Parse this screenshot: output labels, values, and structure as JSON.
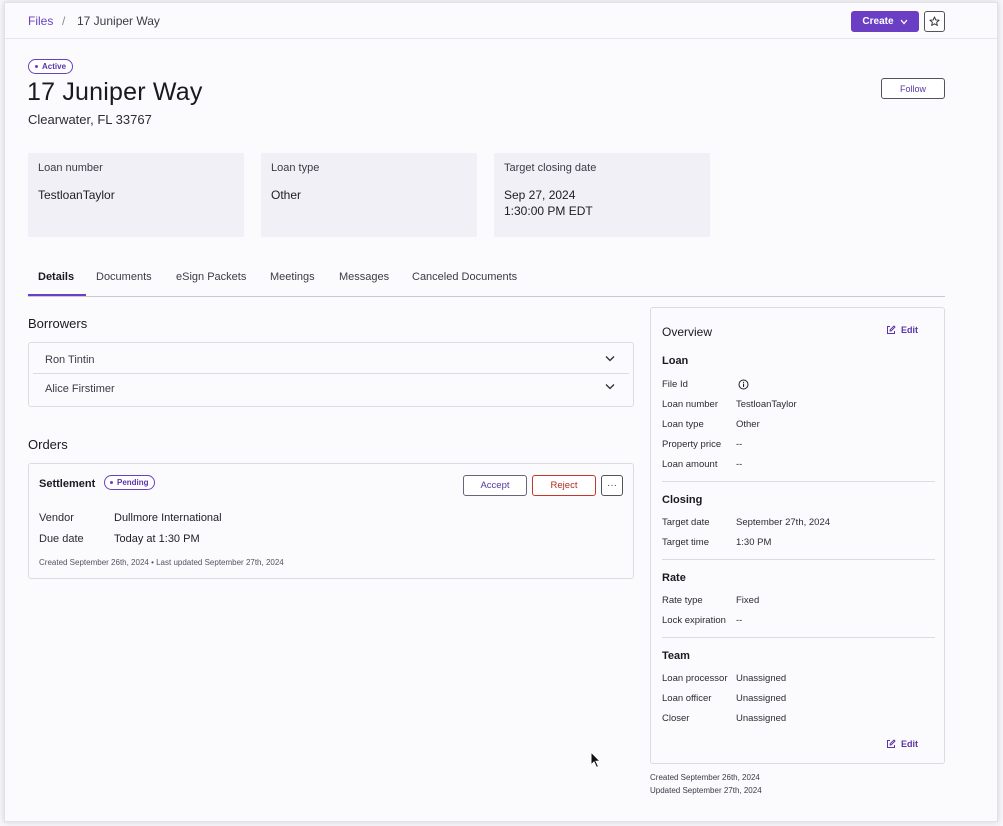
{
  "breadcrumb": {
    "root": "Files",
    "separator": "/",
    "current": "17 Juniper Way"
  },
  "toolbar": {
    "create_label": "Create"
  },
  "header": {
    "status": "Active",
    "title": "17 Juniper Way",
    "address": "Clearwater, FL 33767",
    "follow_label": "Follow"
  },
  "cards": [
    {
      "label": "Loan number",
      "value": "TestloanTaylor"
    },
    {
      "label": "Loan type",
      "value": "Other"
    },
    {
      "label": "Target closing date",
      "value_line1": "Sep 27, 2024",
      "value_line2": "1:30:00 PM EDT"
    }
  ],
  "tabs": [
    {
      "label": "Details"
    },
    {
      "label": "Documents"
    },
    {
      "label": "eSign Packets"
    },
    {
      "label": "Meetings"
    },
    {
      "label": "Messages"
    },
    {
      "label": "Canceled Documents"
    }
  ],
  "borrowers": {
    "heading": "Borrowers",
    "items": [
      {
        "name": "Ron Tintin"
      },
      {
        "name": "Alice Firstimer"
      }
    ]
  },
  "orders": {
    "heading": "Orders",
    "order": {
      "title": "Settlement",
      "status": "Pending",
      "accept_label": "Accept",
      "reject_label": "Reject",
      "more_label": "···",
      "vendor_label": "Vendor",
      "vendor_value": "Dullmore International",
      "due_label": "Due date",
      "due_value": "Today at 1:30 PM",
      "meta": "Created September 26th, 2024 • Last updated September 27th, 2024"
    }
  },
  "overview": {
    "title": "Overview",
    "edit_label": "Edit",
    "loan": {
      "heading": "Loan",
      "file_id_label": "File Id",
      "loan_number_label": "Loan number",
      "loan_number_value": "TestloanTaylor",
      "loan_type_label": "Loan type",
      "loan_type_value": "Other",
      "property_price_label": "Property price",
      "property_price_value": "--",
      "loan_amount_label": "Loan amount",
      "loan_amount_value": "--"
    },
    "closing": {
      "heading": "Closing",
      "target_date_label": "Target date",
      "target_date_value": "September 27th, 2024",
      "target_time_label": "Target time",
      "target_time_value": "1:30 PM"
    },
    "rate": {
      "heading": "Rate",
      "rate_type_label": "Rate type",
      "rate_type_value": "Fixed",
      "lock_expiration_label": "Lock expiration",
      "lock_expiration_value": "--"
    },
    "team": {
      "heading": "Team",
      "loan_processor_label": "Loan processor",
      "loan_processor_value": "Unassigned",
      "loan_officer_label": "Loan officer",
      "loan_officer_value": "Unassigned",
      "closer_label": "Closer",
      "closer_value": "Unassigned"
    },
    "bottom_edit_label": "Edit"
  },
  "footer": {
    "created": "Created September 26th, 2024",
    "updated": "Updated September 27th, 2024"
  },
  "colors": {
    "accent": "#6b3fc4",
    "danger": "#c0392b",
    "card_bg": "#f0f0f6"
  }
}
